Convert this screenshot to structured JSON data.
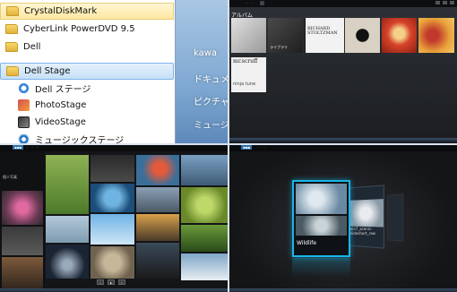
{
  "start_menu": {
    "items": [
      {
        "label": "CrystalDiskMark",
        "type": "folder",
        "state": "highlight"
      },
      {
        "label": "CyberLink PowerDVD 9.5",
        "type": "folder",
        "state": "normal"
      },
      {
        "label": "Dell",
        "type": "folder",
        "state": "normal"
      },
      {
        "label": "Dell Stage",
        "type": "folder",
        "state": "selected"
      },
      {
        "label": "Dell ステージ",
        "type": "app",
        "icon": "dell-stage-icon"
      },
      {
        "label": "PhotoStage",
        "type": "app",
        "icon": "photostage-icon"
      },
      {
        "label": "VideoStage",
        "type": "app",
        "icon": "videostage-icon"
      },
      {
        "label": "ミュージックステージ",
        "type": "app",
        "icon": "music-stage-icon"
      }
    ],
    "right_panel": [
      "kawa",
      "ドキュメ",
      "ピクチャ",
      "ミュージ"
    ]
  },
  "album_view": {
    "title": "アルバム",
    "albums": [
      {
        "caption": "",
        "color": "#cfcfcf"
      },
      {
        "caption": "ライブラリ",
        "color": "#2f2f2f"
      },
      {
        "caption": "",
        "color": "#1b1b1b"
      },
      {
        "title_big": "RICHARD STOLTZMAN",
        "color": "#efefef"
      },
      {
        "caption": "",
        "color": "#c9c2b7"
      },
      {
        "caption": "",
        "color": "#e04a2a"
      },
      {
        "caption": "",
        "color": "#d9882e"
      },
      {
        "title_big": "mr.scruff",
        "subtitle": "ninja tune",
        "color": "#f0f0f0"
      }
    ]
  },
  "photo_view": {
    "side_title": "個人写真"
  },
  "carousel_view": {
    "front_label": "Wildlife",
    "back_label_line1": "win7_scenic-",
    "back_label_line2": "slideshort_raw"
  },
  "colors": {
    "accent": "#19b5e8",
    "selection": "#c6e0f7",
    "highlight": "#fde7a0"
  }
}
